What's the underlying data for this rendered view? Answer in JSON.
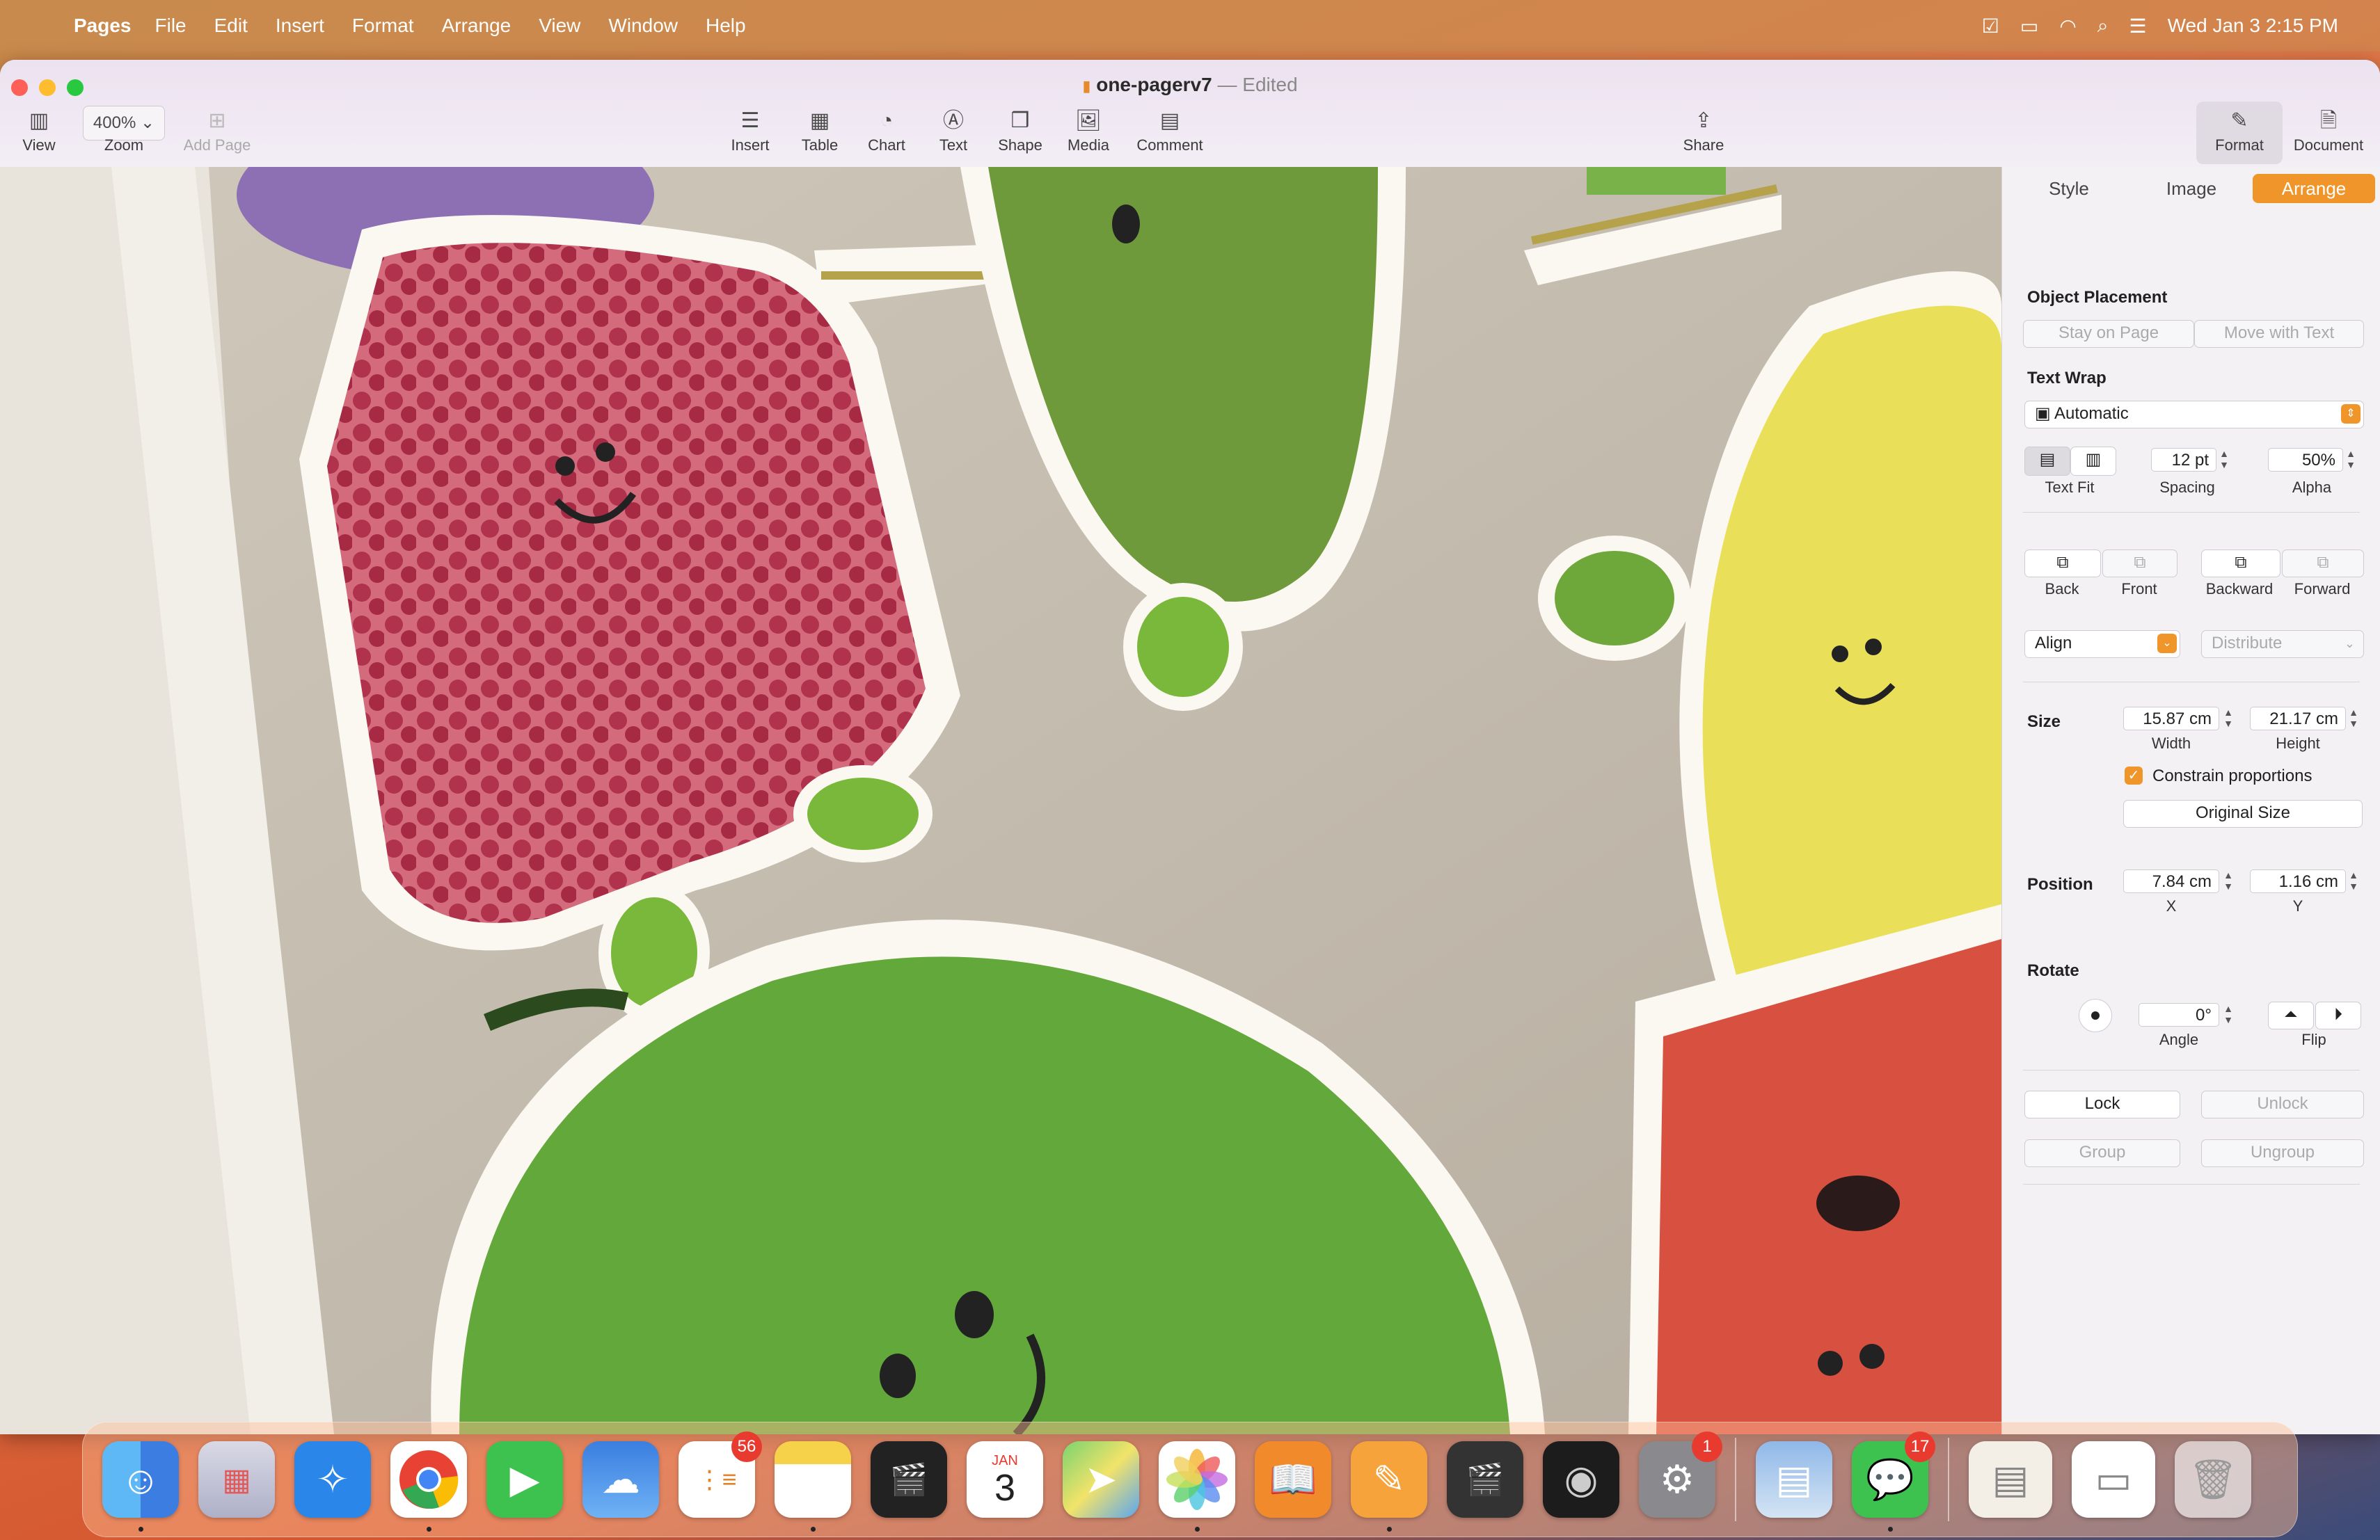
{
  "menubar": {
    "app_name": "Pages",
    "items": [
      "File",
      "Edit",
      "Insert",
      "Format",
      "Arrange",
      "View",
      "Window",
      "Help"
    ],
    "datetime": "Wed Jan 3  2:15 PM"
  },
  "window": {
    "doc_name": "one-pagerv7",
    "doc_state": "— Edited"
  },
  "toolbar": {
    "view": "View",
    "zoom_value": "400%",
    "zoom": "Zoom",
    "add_page": "Add Page",
    "insert": "Insert",
    "table": "Table",
    "chart": "Chart",
    "text": "Text",
    "shape": "Shape",
    "media": "Media",
    "comment": "Comment",
    "share": "Share",
    "format": "Format",
    "document": "Document"
  },
  "inspector": {
    "tabs": [
      "Style",
      "Image",
      "Arrange"
    ],
    "object_placement": "Object Placement",
    "stay_on_page": "Stay on Page",
    "move_with_text": "Move with Text",
    "text_wrap": "Text Wrap",
    "wrap_value": "Automatic",
    "text_fit": "Text Fit",
    "spacing_value": "12 pt",
    "spacing": "Spacing",
    "alpha_value": "50%",
    "alpha": "Alpha",
    "back": "Back",
    "front": "Front",
    "backward": "Backward",
    "forward": "Forward",
    "align": "Align",
    "distribute": "Distribute",
    "size": "Size",
    "width_value": "15.87 cm",
    "width": "Width",
    "height_value": "21.17 cm",
    "height": "Height",
    "constrain": "Constrain proportions",
    "original_size": "Original Size",
    "position": "Position",
    "x_value": "7.84 cm",
    "x": "X",
    "y_value": "1.16 cm",
    "y": "Y",
    "rotate": "Rotate",
    "angle_value": "0°",
    "angle": "Angle",
    "flip": "Flip",
    "lock": "Lock",
    "unlock": "Unlock",
    "group": "Group",
    "ungroup": "Ungroup"
  },
  "dock": {
    "reminders_badge": "56",
    "calendar_month": "JAN",
    "calendar_day": "3",
    "settings_badge": "1",
    "messages_badge": "17"
  },
  "colors": {
    "accent": "#f0952a",
    "badge": "#e83a2f"
  }
}
